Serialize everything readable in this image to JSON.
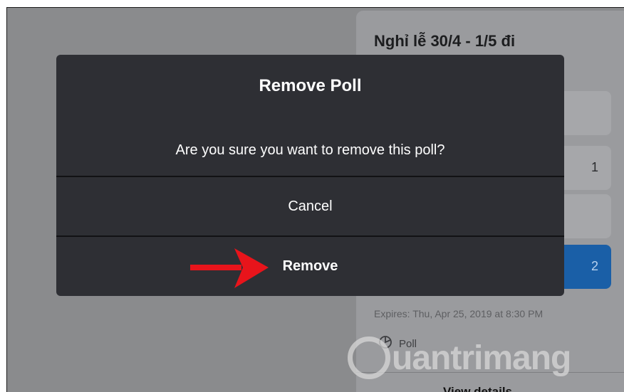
{
  "background": {
    "poll_title": "Nghỉ lễ 30/4 - 1/5 đi",
    "options": [
      {
        "count": ""
      },
      {
        "count": "1"
      },
      {
        "count": ""
      },
      {
        "count": "2",
        "selected": true
      }
    ],
    "expires": "Expires: Thu, Apr 25, 2019 at 8:30 PM",
    "poll_label": "Poll",
    "view_details": "View details"
  },
  "dialog": {
    "title": "Remove Poll",
    "message": "Are you sure you want to remove this poll?",
    "cancel_label": "Cancel",
    "remove_label": "Remove"
  },
  "annotation": {
    "arrow_color": "#e8141b"
  },
  "watermark": {
    "text": "uantrimang"
  },
  "colors": {
    "dialog_bg": "#2e2f34",
    "overlay": "#8a8b8d",
    "selected_option": "#1a5fa7"
  }
}
